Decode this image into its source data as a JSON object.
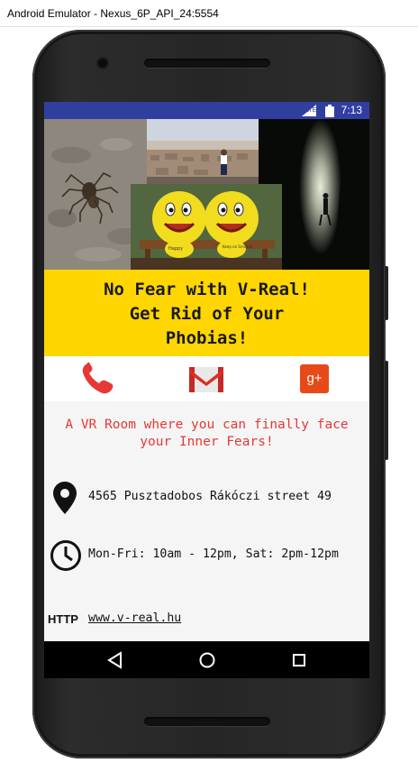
{
  "window": {
    "title": "Android Emulator - Nexus_6P_API_24:5554"
  },
  "status_bar": {
    "time": "7:13",
    "network_label": "LTE",
    "color": "#303f9f"
  },
  "collage": {
    "photos": [
      "spider-photo",
      "city-view-photo",
      "smiley-toys-photo",
      "dark-tunnel-photo"
    ],
    "smiley_captions": [
      "Happy",
      "Keep on Smiling!"
    ]
  },
  "banner": {
    "text": "No Fear with V-Real!\nGet Rid of Your\nPhobias!",
    "color": "#ffd600"
  },
  "contact_buttons": [
    {
      "icon": "phone-icon",
      "color": "#e53935"
    },
    {
      "icon": "gmail-icon",
      "color": "#d93025"
    },
    {
      "icon": "google-plus-icon",
      "label": "g+",
      "color": "#e64a19"
    }
  ],
  "tagline": "A VR Room where you can finally face\nyour Inner Fears!",
  "info": {
    "address": "4565 Pusztadobos Rákóczi street 49",
    "hours": "Mon-Fri: 10am - 12pm, Sat: 2pm-12pm",
    "http_label": "HTTP",
    "website": "www.v-real.hu"
  },
  "nav_bar": {
    "buttons": [
      "back-icon",
      "home-icon",
      "recents-icon"
    ]
  }
}
